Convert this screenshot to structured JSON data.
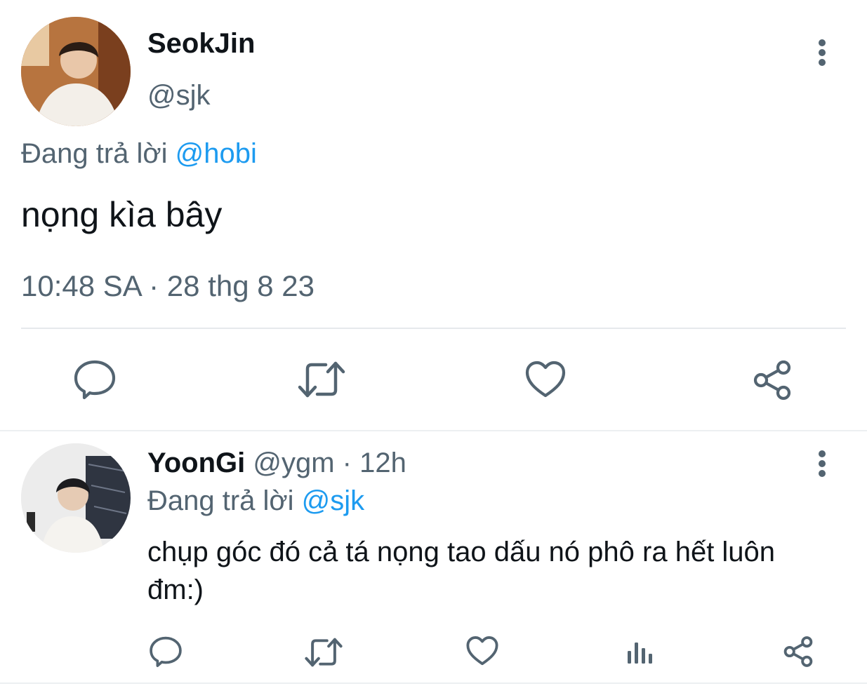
{
  "main_tweet": {
    "display_name": "SeokJin",
    "handle": "@sjk",
    "replying_prefix": "Đang trả lời",
    "replying_to": "@hobi",
    "text": "nọng kìa bây",
    "timestamp": "10:48 SA · 28 thg 8 23",
    "icons": {
      "more": "more-vertical-icon",
      "reply": "reply-icon",
      "retweet": "retweet-icon",
      "like": "heart-icon",
      "share": "share-icon"
    }
  },
  "reply_tweet": {
    "display_name": "YoonGi",
    "handle": "@ygm",
    "separator": "·",
    "time": "12h",
    "replying_prefix": "Đang trả lời",
    "replying_to": "@sjk",
    "text": "chụp góc đó cả tá nọng tao dấu nó phô ra hết luôn đm:)",
    "icons": {
      "more": "more-vertical-icon",
      "reply": "reply-icon",
      "retweet": "retweet-icon",
      "like": "heart-icon",
      "views": "views-chart-icon",
      "share": "share-icon"
    }
  },
  "colors": {
    "text": "#0f1419",
    "muted": "#536471",
    "link": "#1d9bf0",
    "divider": "#e6e9ec"
  }
}
